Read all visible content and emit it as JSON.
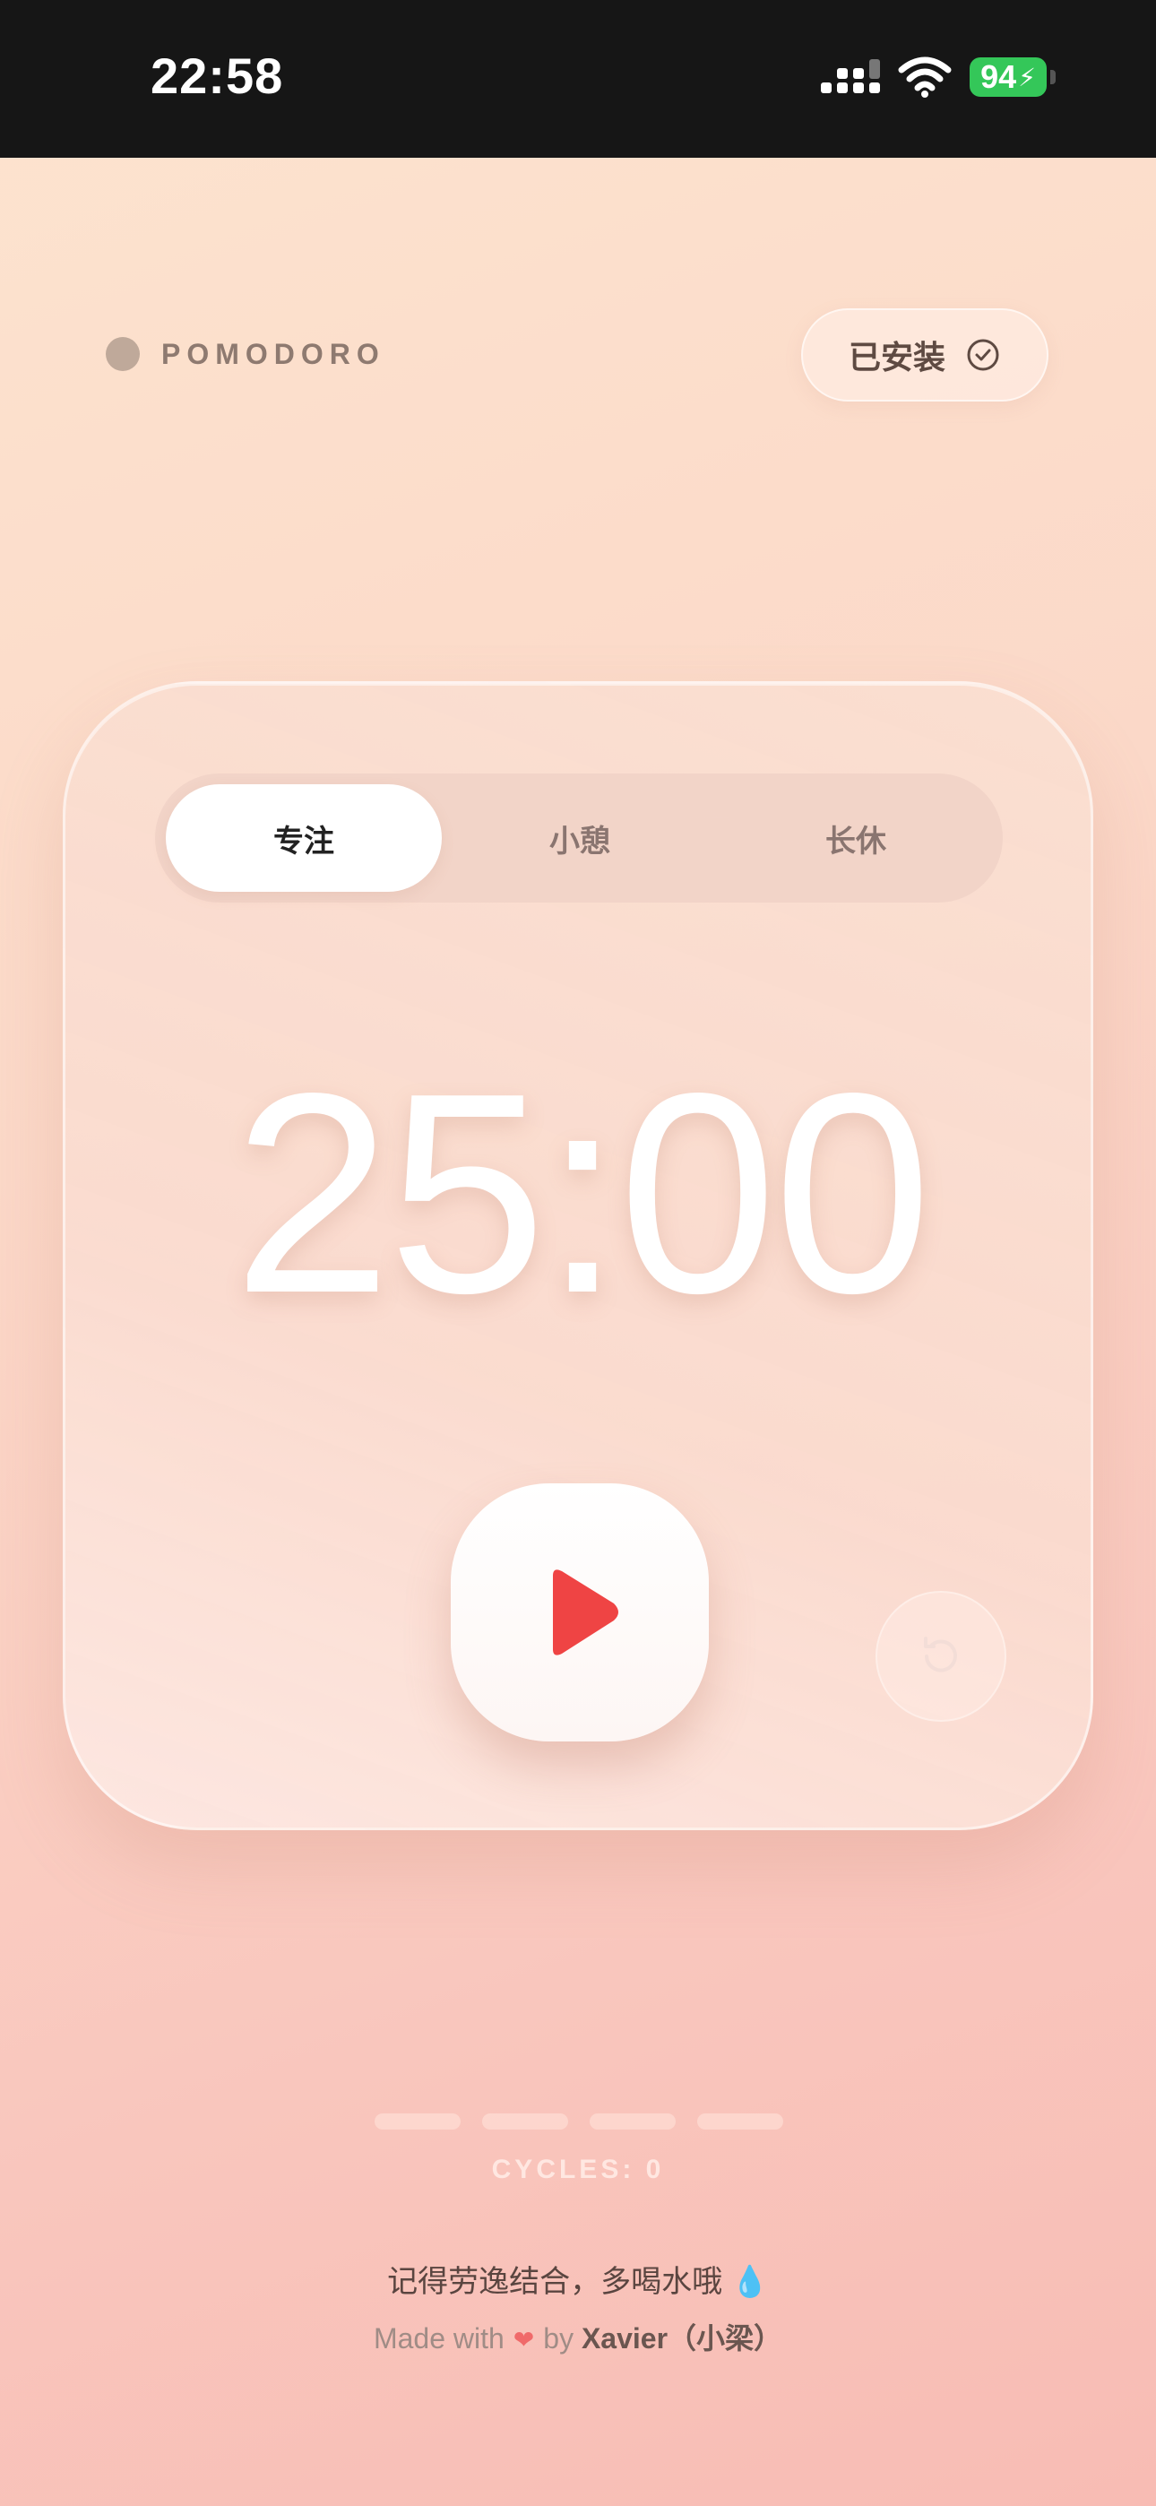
{
  "status_bar": {
    "time": "22:58",
    "battery": "94"
  },
  "header": {
    "brand": "POMODORO",
    "installed_label": "已安装"
  },
  "tabs": [
    {
      "label": "专注",
      "active": true
    },
    {
      "label": "小憩",
      "active": false
    },
    {
      "label": "长休",
      "active": false
    }
  ],
  "timer": {
    "display": "25:00"
  },
  "controls": {
    "play_icon": "play-icon",
    "reset_icon": "reset-icon"
  },
  "cycles": {
    "label": "CYCLES: 0",
    "total_slots": 4,
    "completed": 0
  },
  "footer": {
    "tip": "记得劳逸结合，多喝水哦 💧",
    "made_with": "Made with",
    "by": "by",
    "author": "Xavier（小梁）"
  },
  "colors": {
    "accent": "#ef4444",
    "battery": "#34c759"
  }
}
